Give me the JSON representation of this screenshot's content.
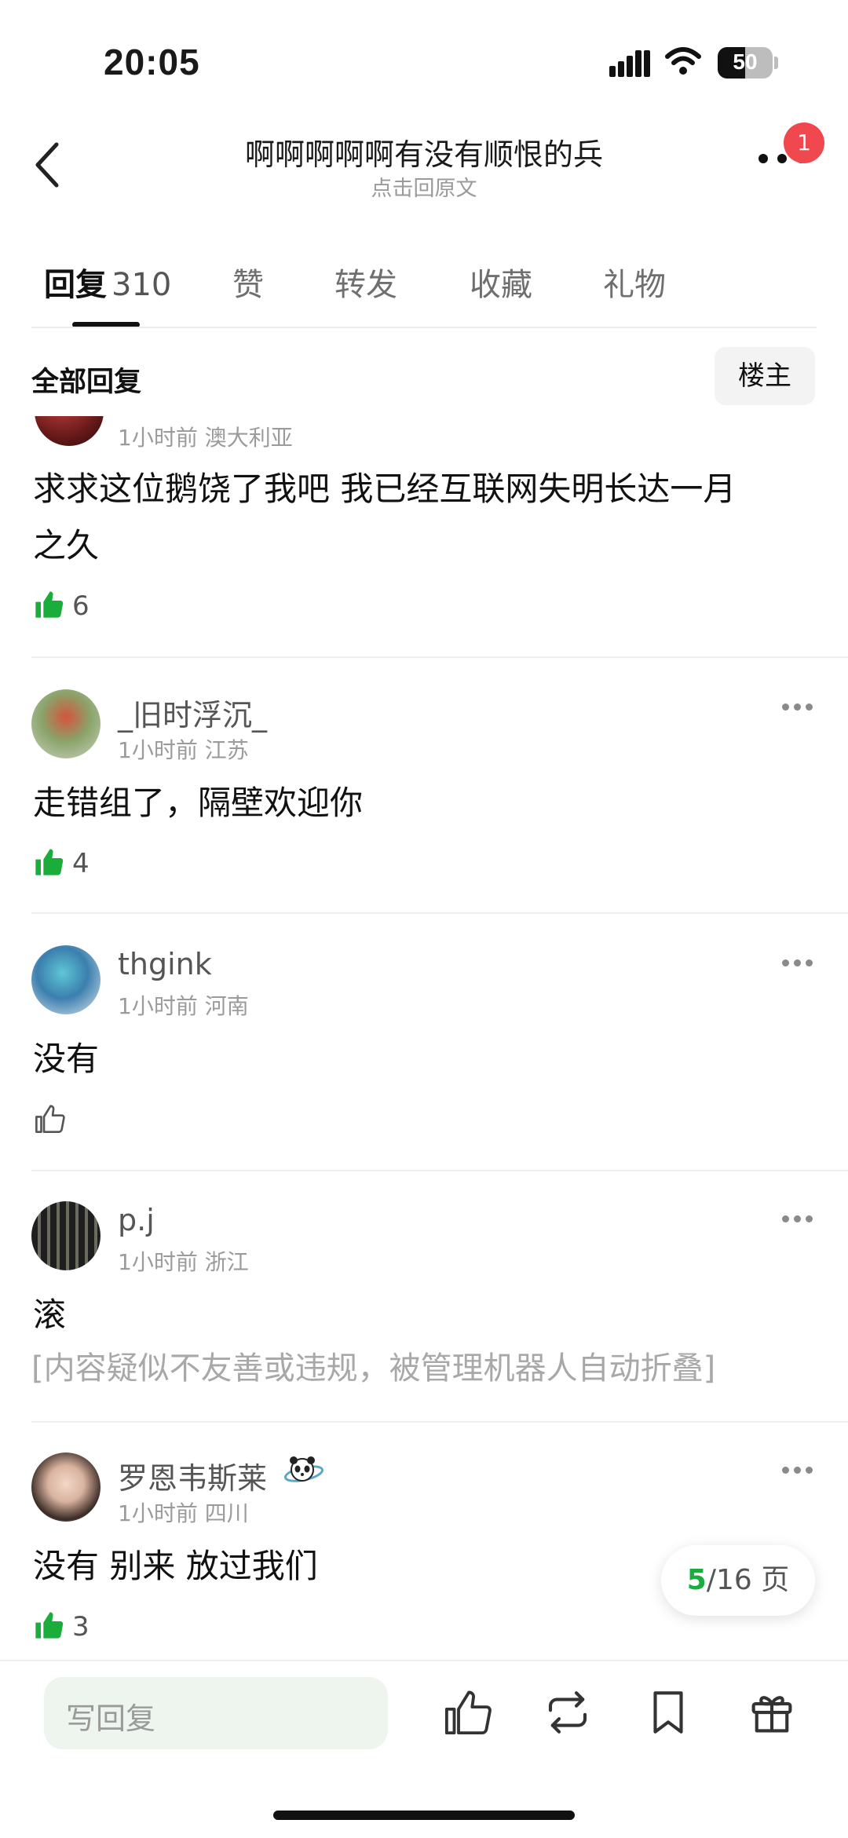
{
  "status_bar": {
    "time": "20:05",
    "battery": "50"
  },
  "header": {
    "title": "啊啊啊啊啊有没有顺恨的兵",
    "subtitle": "点击回原文",
    "notification_count": "1"
  },
  "tabs": [
    {
      "label": "回复",
      "count": "310"
    },
    {
      "label": "赞"
    },
    {
      "label": "转发"
    },
    {
      "label": "收藏"
    },
    {
      "label": "礼物"
    }
  ],
  "filter": {
    "label": "全部回复",
    "owner_button": "楼主"
  },
  "comments": [
    {
      "meta": "1小时前 澳大利亚",
      "content_line1": "求求这位鹅饶了我吧 我已经互联网失明长达一月",
      "content_line2": "之久",
      "likes": "6",
      "liked": true
    },
    {
      "username": "_旧时浮沉_",
      "meta": "1小时前 江苏",
      "content": "走错组了，隔壁欢迎你",
      "likes": "4",
      "liked": true
    },
    {
      "username": "thgink",
      "meta": "1小时前 河南",
      "content": "没有",
      "likes": "",
      "liked": false
    },
    {
      "username": "p.j",
      "meta": "1小时前 浙江",
      "content": "滚",
      "folded_notice": "[内容疑似不友善或违规，被管理机器人自动折叠]",
      "likes": "",
      "liked": false
    },
    {
      "username": "罗恩韦斯莱",
      "meta": "1小时前 四川",
      "content": "没有 别来 放过我们",
      "likes": "3",
      "liked": true
    }
  ],
  "pagination": {
    "current": "5",
    "total": "/16 页"
  },
  "bottom_bar": {
    "reply_placeholder": "写回复"
  },
  "colors": {
    "accent_green": "#1aad3b",
    "badge_red": "#f0484f"
  }
}
